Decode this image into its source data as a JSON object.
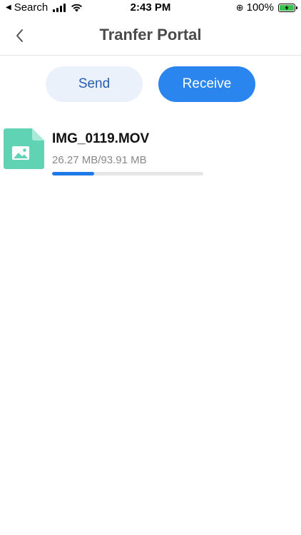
{
  "status_bar": {
    "back_label": "Search",
    "time": "2:43 PM",
    "battery": "100%"
  },
  "header": {
    "title": "Tranfer Portal"
  },
  "tabs": [
    {
      "label": "Send",
      "active": false
    },
    {
      "label": "Receive",
      "active": true
    }
  ],
  "files": [
    {
      "name": "IMG_0119.MOV",
      "size_text": "26.27 MB/93.91 MB",
      "progress": 0.28,
      "icon": "image-file-icon"
    }
  ],
  "colors": {
    "accent": "#2a86ee",
    "send_bg": "#eaf1fb",
    "progress": "#1f7ae8",
    "file_icon": "#5fd3b3"
  }
}
